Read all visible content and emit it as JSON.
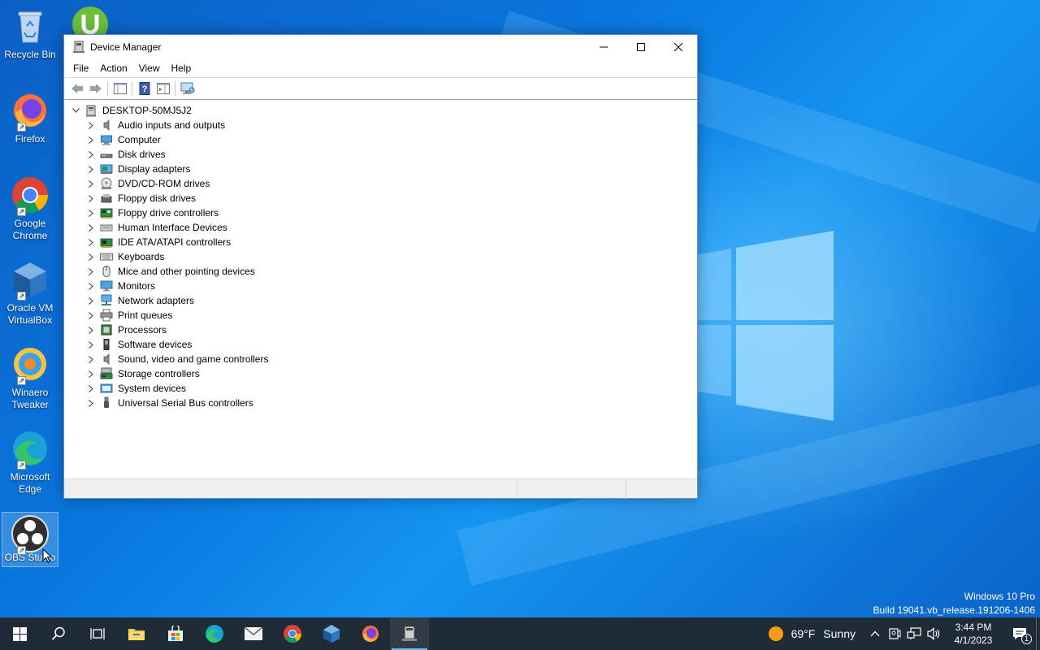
{
  "desktop": {
    "icons": [
      {
        "label": "Recycle Bin"
      },
      {
        "label": "Firefox"
      },
      {
        "label": "Google Chrome"
      },
      {
        "label": "Oracle VM VirtualBox"
      },
      {
        "label": "Winaero Tweaker"
      },
      {
        "label": "Microsoft Edge"
      },
      {
        "label": "OBS Studio"
      }
    ],
    "watermark": {
      "line1": "Windows 10 Pro",
      "line2": "Build 19041.vb_release.191206-1406"
    }
  },
  "window": {
    "title": "Device Manager",
    "menu": [
      "File",
      "Action",
      "View",
      "Help"
    ],
    "tree": {
      "root": "DESKTOP-50MJ5J2",
      "items": [
        {
          "label": "Audio inputs and outputs",
          "icon": "speaker-icon"
        },
        {
          "label": "Computer",
          "icon": "computer-icon"
        },
        {
          "label": "Disk drives",
          "icon": "disk-drive-icon"
        },
        {
          "label": "Display adapters",
          "icon": "display-adapter-icon"
        },
        {
          "label": "DVD/CD-ROM drives",
          "icon": "dvd-drive-icon"
        },
        {
          "label": "Floppy disk drives",
          "icon": "floppy-disk-icon"
        },
        {
          "label": "Floppy drive controllers",
          "icon": "floppy-controller-icon"
        },
        {
          "label": "Human Interface Devices",
          "icon": "hid-icon"
        },
        {
          "label": "IDE ATA/ATAPI controllers",
          "icon": "ide-controller-icon"
        },
        {
          "label": "Keyboards",
          "icon": "keyboard-icon"
        },
        {
          "label": "Mice and other pointing devices",
          "icon": "mouse-icon"
        },
        {
          "label": "Monitors",
          "icon": "monitor-icon"
        },
        {
          "label": "Network adapters",
          "icon": "network-adapter-icon"
        },
        {
          "label": "Print queues",
          "icon": "printer-icon"
        },
        {
          "label": "Processors",
          "icon": "processor-icon"
        },
        {
          "label": "Software devices",
          "icon": "software-device-icon"
        },
        {
          "label": "Sound, video and game controllers",
          "icon": "sound-icon"
        },
        {
          "label": "Storage controllers",
          "icon": "storage-controller-icon"
        },
        {
          "label": "System devices",
          "icon": "system-device-icon"
        },
        {
          "label": "Universal Serial Bus controllers",
          "icon": "usb-icon"
        }
      ]
    }
  },
  "taskbar": {
    "weather": {
      "temp": "69°F",
      "condition": "Sunny"
    },
    "clock": {
      "time": "3:44 PM",
      "date": "4/1/2023"
    },
    "notification_count": "1"
  }
}
